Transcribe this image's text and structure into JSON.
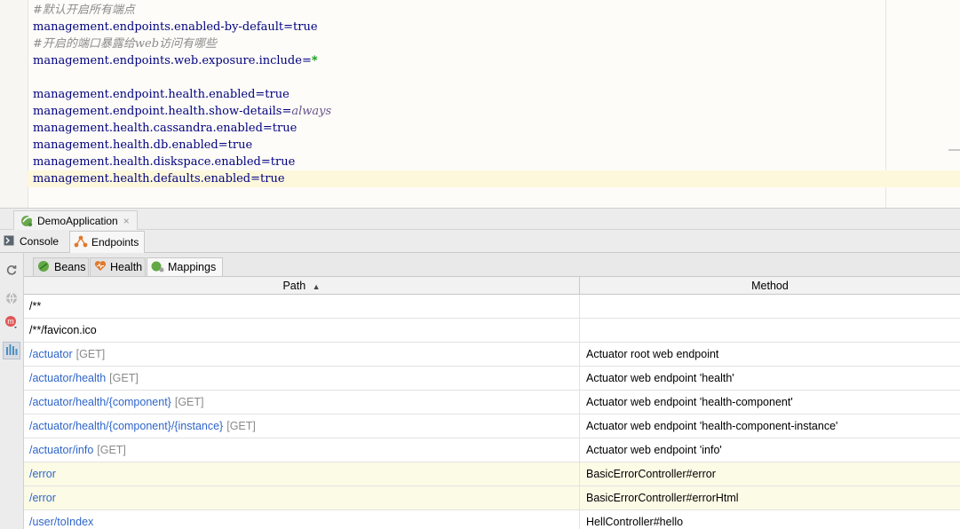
{
  "editor": {
    "lines": [
      {
        "type": "comment",
        "text": "#默认开启所有端点"
      },
      {
        "type": "kv",
        "key": "management.endpoints.enabled-by-default=",
        "value": "true",
        "value_style": "key"
      },
      {
        "type": "comment",
        "text": "#开启的端口暴露给web访问有哪些"
      },
      {
        "type": "kv",
        "key": "management.endpoints.web.exposure.include=",
        "value": "*",
        "value_style": "star"
      },
      {
        "type": "blank",
        "text": ""
      },
      {
        "type": "kv",
        "key": "management.endpoint.health.enabled=",
        "value": "true",
        "value_style": "key"
      },
      {
        "type": "kv",
        "key": "management.endpoint.health.show-details=",
        "value": "always",
        "value_style": "italic"
      },
      {
        "type": "kv",
        "key": "management.health.cassandra.enabled=",
        "value": "true",
        "value_style": "key"
      },
      {
        "type": "kv",
        "key": "management.health.db.enabled=",
        "value": "true",
        "value_style": "key"
      },
      {
        "type": "kv",
        "key": "management.health.diskspace.enabled=",
        "value": "true",
        "value_style": "key"
      },
      {
        "type": "kv",
        "key": "management.health.defaults.enabled=",
        "value": "true",
        "value_style": "key",
        "current": true
      }
    ]
  },
  "run_tab": {
    "label": "DemoApplication",
    "close": "×"
  },
  "tool_tabs": [
    {
      "label": "Console",
      "icon": "console-icon"
    },
    {
      "label": "Endpoints",
      "icon": "endpoints-icon",
      "active": true
    }
  ],
  "left_toolbar": [
    {
      "name": "refresh-icon"
    },
    {
      "name": "globe-icon"
    },
    {
      "name": "maven-icon"
    },
    {
      "name": "diagram-icon",
      "selected": true
    }
  ],
  "sub_tabs": [
    {
      "label": "Beans",
      "icon": "beans-icon"
    },
    {
      "label": "Health",
      "icon": "health-icon"
    },
    {
      "label": "Mappings",
      "icon": "mappings-icon",
      "active": true
    }
  ],
  "table": {
    "headers": {
      "path": "Path",
      "sort": "▲",
      "method": "Method"
    },
    "rows": [
      {
        "path": "/**",
        "verb": "",
        "method": "",
        "link": false,
        "hl": false
      },
      {
        "path": "/**/favicon.ico",
        "verb": "",
        "method": "",
        "link": false,
        "hl": false
      },
      {
        "path": "/actuator",
        "verb": "[GET]",
        "method": "Actuator root web endpoint",
        "link": true,
        "hl": false
      },
      {
        "path": "/actuator/health",
        "verb": "[GET]",
        "method": "Actuator web endpoint 'health'",
        "link": true,
        "hl": false
      },
      {
        "path": "/actuator/health/{component}",
        "verb": "[GET]",
        "method": "Actuator web endpoint 'health-component'",
        "link": true,
        "hl": false
      },
      {
        "path": "/actuator/health/{component}/{instance}",
        "verb": "[GET]",
        "method": "Actuator web endpoint 'health-component-instance'",
        "link": true,
        "hl": false
      },
      {
        "path": "/actuator/info",
        "verb": "[GET]",
        "method": "Actuator web endpoint 'info'",
        "link": true,
        "hl": false
      },
      {
        "path": "/error",
        "verb": "",
        "method": "BasicErrorController#error",
        "link": true,
        "hl": true
      },
      {
        "path": "/error",
        "verb": "",
        "method": "BasicErrorController#errorHtml",
        "link": true,
        "hl": true
      },
      {
        "path": "/user/toIndex",
        "verb": "",
        "method": "HellController#hello",
        "link": true,
        "hl": false
      }
    ]
  }
}
